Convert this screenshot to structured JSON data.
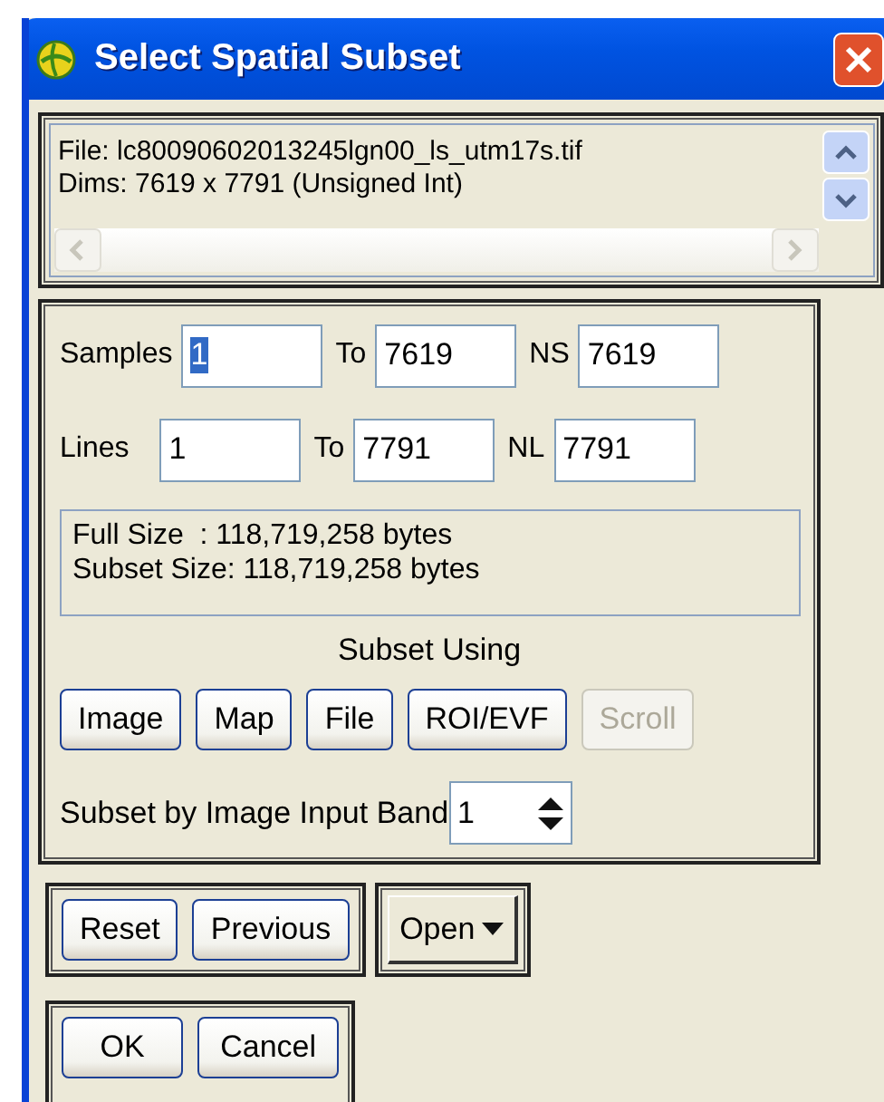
{
  "window": {
    "title": "Select Spatial Subset"
  },
  "file_info": {
    "lines": [
      "File: lc80090602013245lgn00_ls_utm17s.tif",
      "Dims: 7619 x 7791 (Unsigned Int)"
    ]
  },
  "ranges": [
    {
      "label": "Samples",
      "from": "1",
      "from_selected": true,
      "to_label": "To",
      "to": "7619",
      "count_label": "NS",
      "count": "7619"
    },
    {
      "label": "Lines",
      "from": "1",
      "from_selected": false,
      "to_label": "To",
      "to": "7791",
      "count_label": "NL",
      "count": "7791"
    }
  ],
  "size_info": [
    "Full Size  : 118,719,258 bytes",
    "Subset Size: 118,719,258 bytes"
  ],
  "subset_using": {
    "label": "Subset Using",
    "buttons": [
      {
        "label": "Image",
        "disabled": false
      },
      {
        "label": "Map",
        "disabled": false
      },
      {
        "label": "File",
        "disabled": false
      },
      {
        "label": "ROI/EVF",
        "disabled": false
      },
      {
        "label": "Scroll",
        "disabled": true
      }
    ]
  },
  "band": {
    "label": "Subset by Image Input Band",
    "value": "1"
  },
  "history_buttons": [
    "Reset",
    "Previous"
  ],
  "open_button": {
    "label": "Open"
  },
  "dialog_buttons": [
    "OK",
    "Cancel"
  ]
}
